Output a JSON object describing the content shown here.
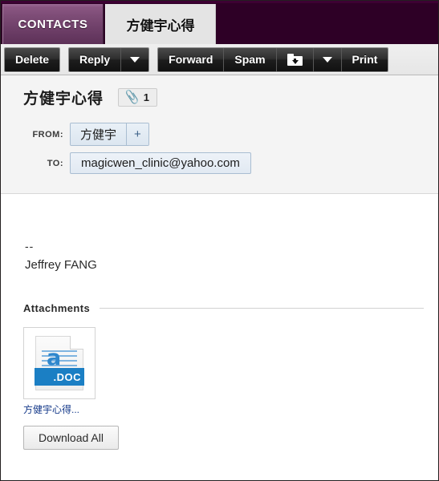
{
  "colors": {
    "tabbar_bg": "#2e0026",
    "tab_active_bg": "#e4e4e4",
    "accent_purple": "#7d4c76",
    "link": "#153a8a",
    "doc_blue": "#1b7fc4"
  },
  "tabs": [
    {
      "id": "contacts",
      "label": "CONTACTS",
      "active": false
    },
    {
      "id": "message",
      "label": "方健宇心得",
      "active": true
    }
  ],
  "toolbar": {
    "delete_label": "Delete",
    "reply_label": "Reply",
    "reply_caret_icon": "chevron-down-icon",
    "forward_label": "Forward",
    "spam_label": "Spam",
    "move_icon": "folder-move-icon",
    "move_caret_icon": "chevron-down-icon",
    "print_label": "Print"
  },
  "message": {
    "subject": "方健宇心得",
    "attachment_badge": {
      "icon": "paperclip-icon",
      "count": "1"
    },
    "from": {
      "label": "FROM:",
      "sender": "方健宇",
      "add_label": "+"
    },
    "to": {
      "label": "TO:",
      "value": "magicwen_clinic@yahoo.com"
    },
    "body": {
      "signature_separator": "--",
      "signature_name": "Jeffrey FANG"
    }
  },
  "attachments": {
    "title": "Attachments",
    "items": [
      {
        "filename": "方健宇心得...",
        "type_label": ".DOC",
        "icon": "doc-file-icon"
      }
    ],
    "download_all_label": "Download All"
  }
}
